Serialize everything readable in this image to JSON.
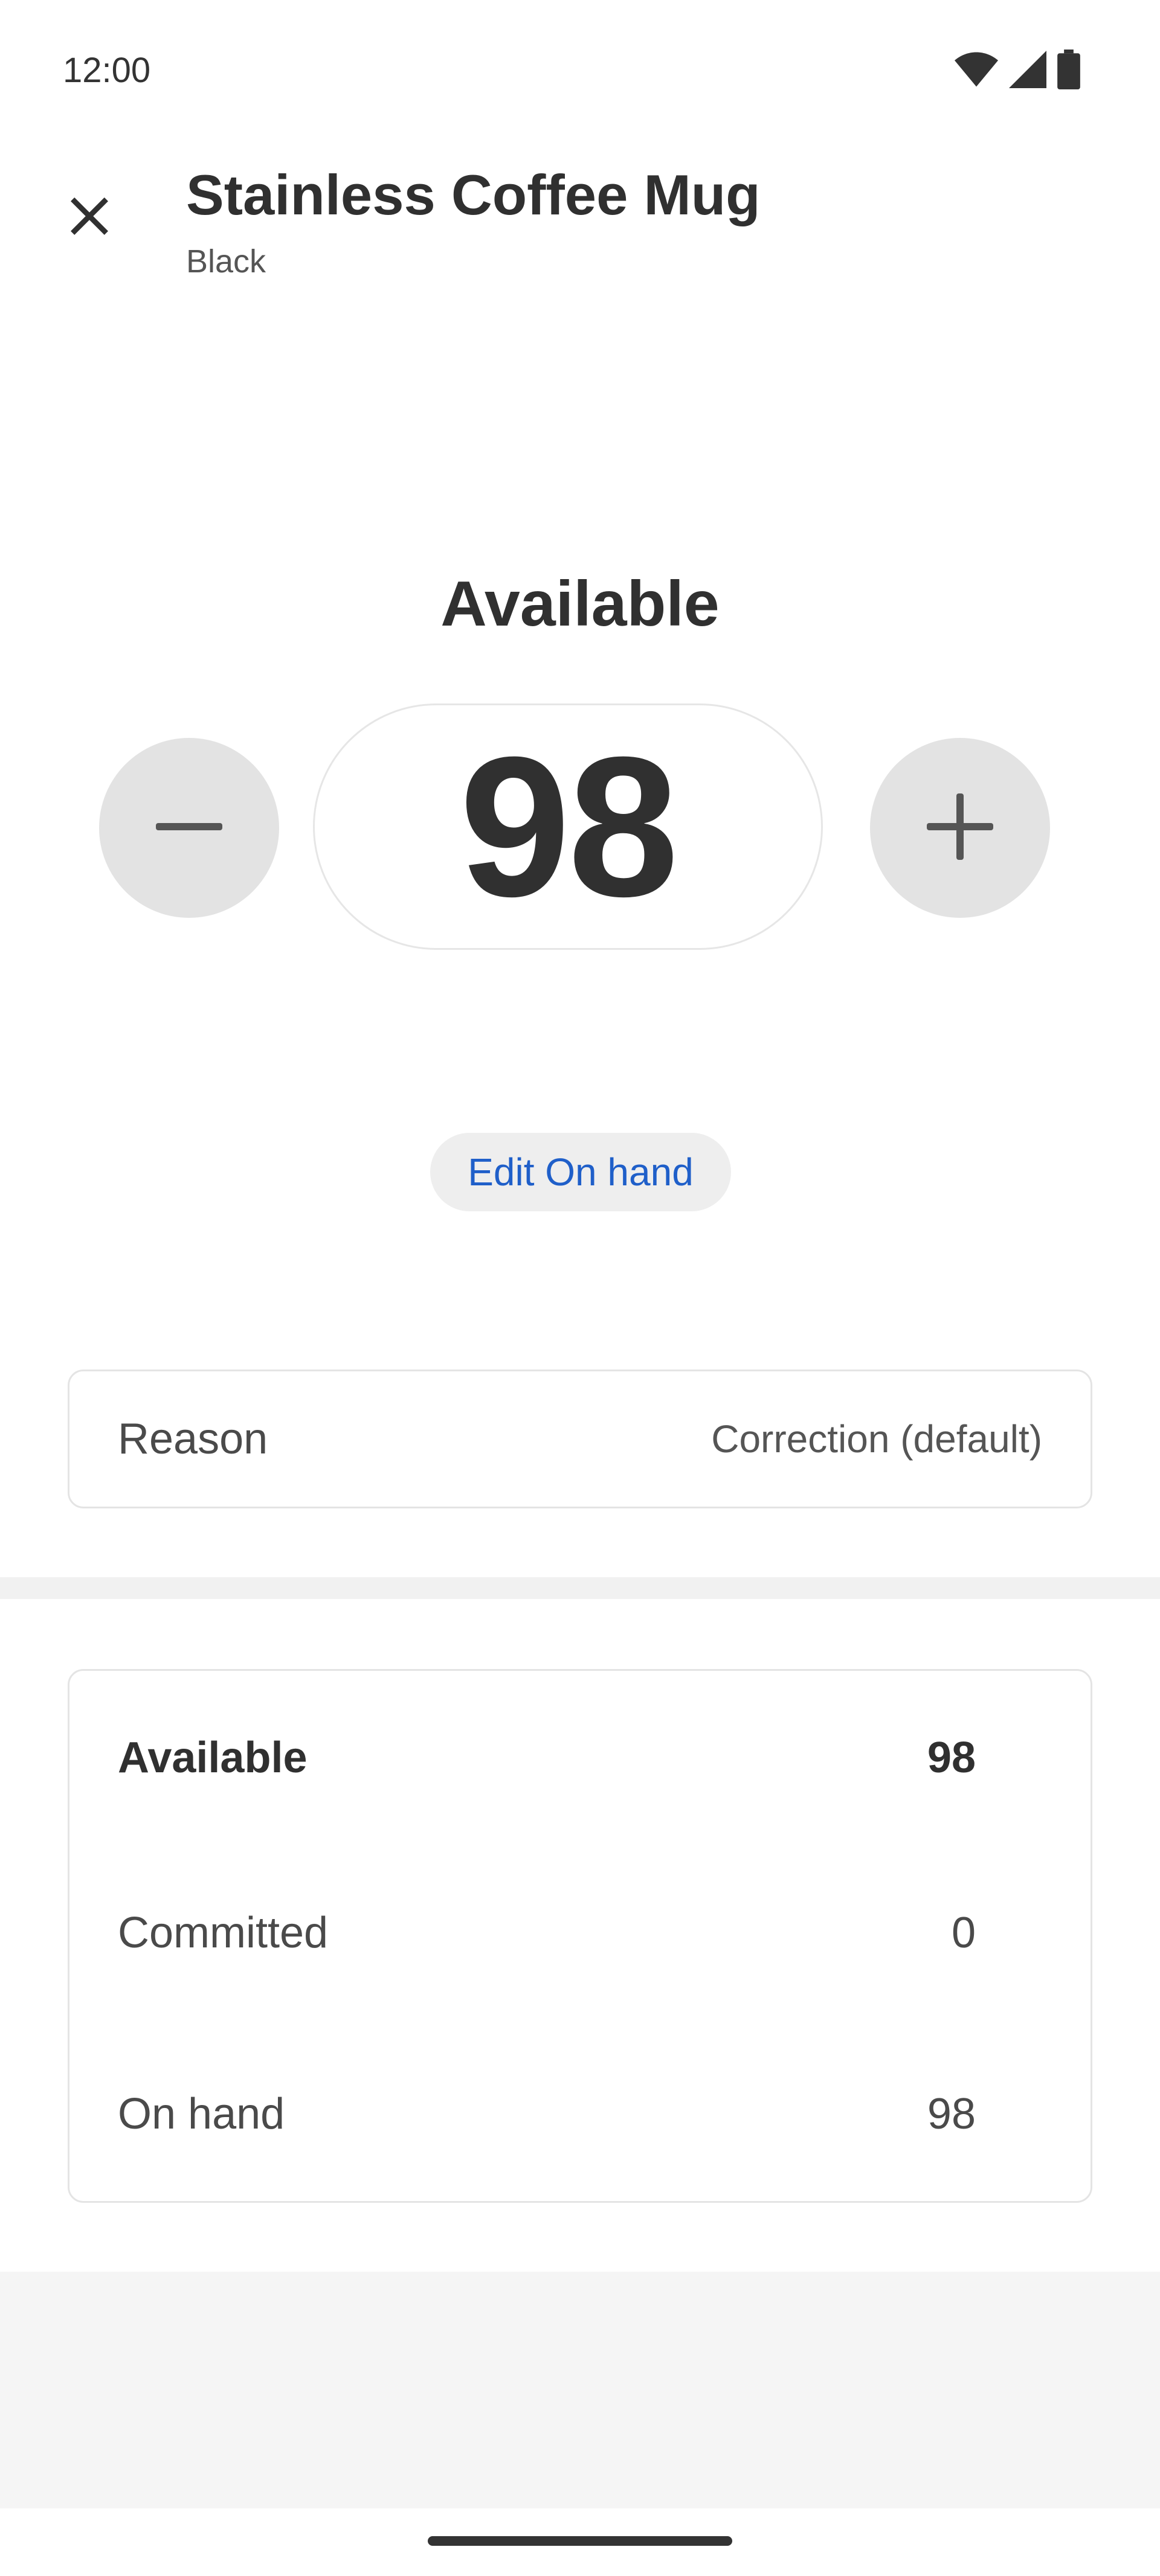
{
  "status_bar": {
    "time": "12:00",
    "icons": [
      "wifi-icon",
      "cellular-signal-icon",
      "battery-icon"
    ]
  },
  "header": {
    "close_icon": "close-icon",
    "title": "Stainless Coffee Mug",
    "subtitle": "Black"
  },
  "adjuster": {
    "heading": "Available",
    "value": "98",
    "decrement_icon": "minus-icon",
    "increment_icon": "plus-icon"
  },
  "edit_button": {
    "label": "Edit On hand"
  },
  "reason": {
    "label": "Reason",
    "value": "Correction (default)"
  },
  "summary": {
    "rows": [
      {
        "label": "Available",
        "value": "98"
      },
      {
        "label": "Committed",
        "value": "0"
      },
      {
        "label": "On hand",
        "value": "98"
      }
    ]
  },
  "colors": {
    "accent_link": "#1f5fc9",
    "step_button_bg": "#e3e3e3",
    "chip_bg": "#eeeeee",
    "text_primary": "#303030"
  }
}
